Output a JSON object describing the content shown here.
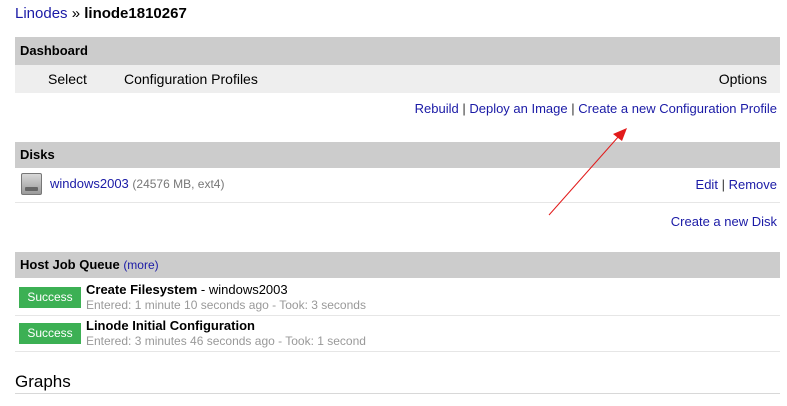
{
  "breadcrumb": {
    "parent": "Linodes",
    "separator": "»",
    "current": "linode1810267"
  },
  "dashboard": {
    "title": "Dashboard",
    "columns": {
      "select": "Select",
      "profiles": "Configuration Profiles",
      "options": "Options"
    },
    "links": {
      "rebuild": "Rebuild",
      "sep": "|",
      "deploy": "Deploy an Image",
      "create_profile": "Create a new Configuration Profile"
    }
  },
  "disks": {
    "title": "Disks",
    "items": [
      {
        "name": "windows2003",
        "details": "(24576 MB, ext4)",
        "edit": "Edit",
        "sep": "|",
        "remove": "Remove"
      }
    ],
    "create": "Create a new Disk"
  },
  "jobs": {
    "title": "Host Job Queue",
    "more": "(more)",
    "items": [
      {
        "status": "Success",
        "title": "Create Filesystem",
        "target": "- windows2003",
        "meta": "Entered: 1 minute 10 seconds ago - Took: 3 seconds"
      },
      {
        "status": "Success",
        "title": "Linode Initial Configuration",
        "target": "",
        "meta": "Entered: 3 minutes 46 seconds ago - Took: 1 second"
      }
    ]
  },
  "graphs": {
    "title": "Graphs"
  },
  "colors": {
    "header_bg": "#cccccc",
    "success": "#3cb054",
    "link": "#1a1aa6",
    "annotation": "#e21b1b"
  }
}
